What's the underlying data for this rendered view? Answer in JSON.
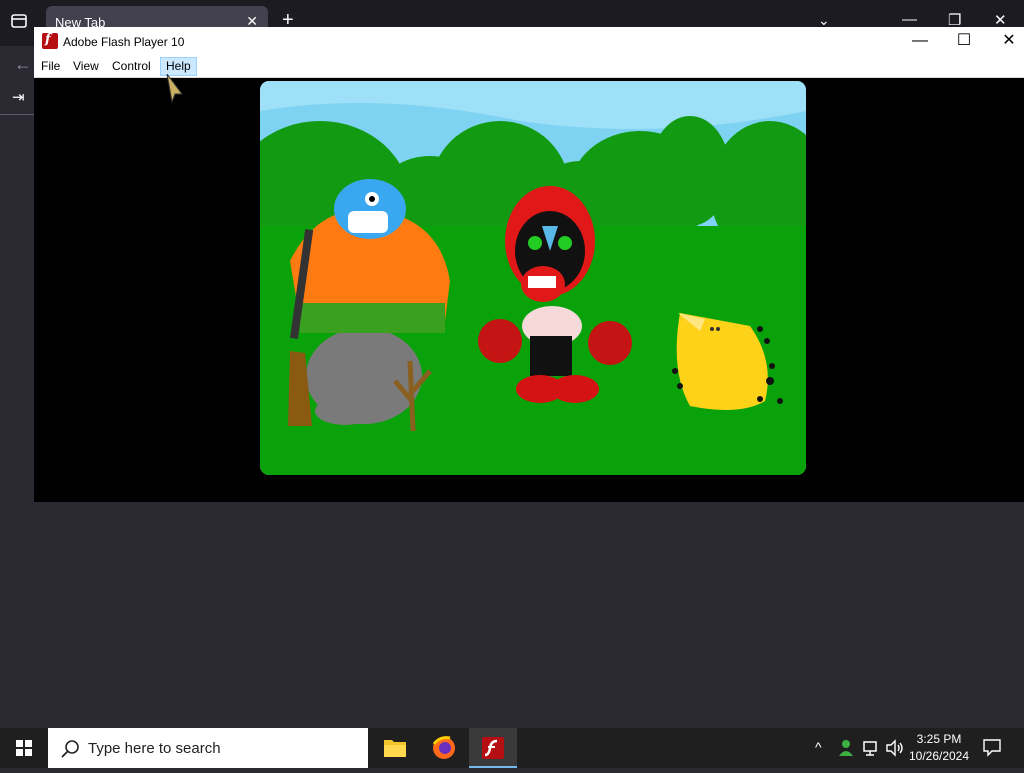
{
  "browser": {
    "tab_title": "New Tab",
    "tab_close": "✕",
    "new_tab": "+",
    "list_all_tabs": "⌄",
    "minimize": "—",
    "restore": "❐",
    "close": "✕",
    "back": "←",
    "sign_in": "⇥"
  },
  "flash_window": {
    "title": "Adobe Flash Player 10",
    "icon_letter": "f",
    "controls": {
      "minimize": "—",
      "maximize": "☐",
      "close": "✕"
    },
    "menu": [
      "File",
      "View",
      "Control",
      "Help"
    ]
  },
  "game": {
    "characters": [
      "orange-hunter-with-shotgun",
      "red-masked-boxer",
      "yellow-spotted-creature"
    ],
    "colors": {
      "sky": "#7fd3f2",
      "trees": "#129612",
      "grass": "#0aa20a"
    }
  },
  "taskbar": {
    "search_placeholder": "Type here to search",
    "apps": [
      "file-explorer",
      "firefox",
      "flash-player"
    ],
    "time": "3:25 PM",
    "date": "10/26/2024"
  },
  "colors": {
    "taskbar": "#1f1f1f",
    "flash_red": "#b50f13",
    "menu_highlight": "#cce8ff"
  }
}
